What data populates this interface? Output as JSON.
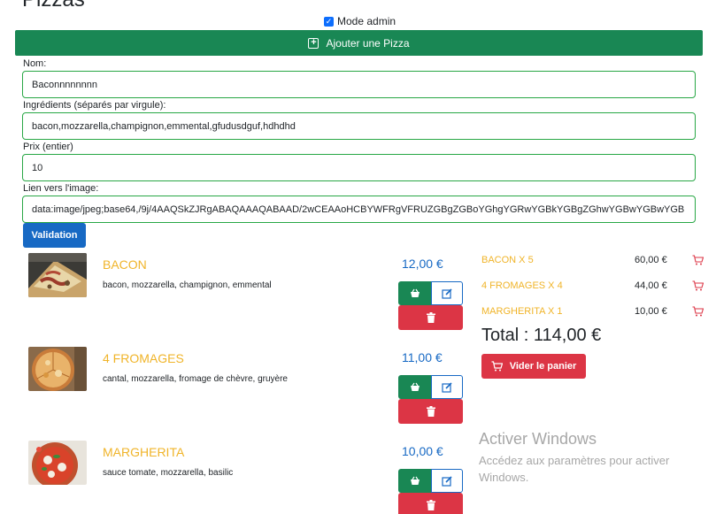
{
  "header": {
    "title": "Pizzas",
    "admin_label": "Mode admin",
    "admin_checked": true
  },
  "add_button": {
    "label": "Ajouter une Pizza"
  },
  "form": {
    "name_label": "Nom:",
    "name_value": "Baconnnnnnnn",
    "ingredients_label": "Ingrédients (séparés par virgule):",
    "ingredients_value": "bacon,mozzarella,champignon,emmental,gfudusdguf,hdhdhd",
    "price_label": "Prix (entier)",
    "price_value": "10",
    "image_label": "Lien vers l'image:",
    "image_value": "data:image/jpeg;base64,/9j/4AAQSkZJRgABAQAAAQABAAD/2wCEAAoHCBYWFRgVFRUZGBgZGBoYGhgYGRwYGBkYGBgZGhwYGBwYGBwYGB",
    "validate_label": "Validation"
  },
  "pizzas": [
    {
      "name": "BACON",
      "ingredients": "bacon, mozzarella, champignon, emmental",
      "price": "12,00 €"
    },
    {
      "name": "4 FROMAGES",
      "ingredients": "cantal, mozzarella, fromage de chèvre, gruyère",
      "price": "11,00 €"
    },
    {
      "name": "MARGHERITA",
      "ingredients": "sauce tomate, mozzarella, basilic",
      "price": "10,00 €"
    }
  ],
  "cart": {
    "lines": [
      {
        "label": "BACON X 5",
        "total": "60,00 €"
      },
      {
        "label": "4 FROMAGES X 4",
        "total": "44,00 €"
      },
      {
        "label": "MARGHERITA X 1",
        "total": "10,00 €"
      }
    ],
    "total_label": "Total : 114,00 €",
    "empty_label": "Vider le panier"
  },
  "watermark": {
    "title": "Activer Windows",
    "text": "Accédez aux paramètres pour activer Windows."
  },
  "colors": {
    "green": "#198754",
    "blue": "#1769c4",
    "red": "#dc3545",
    "gold": "#f0b429"
  }
}
